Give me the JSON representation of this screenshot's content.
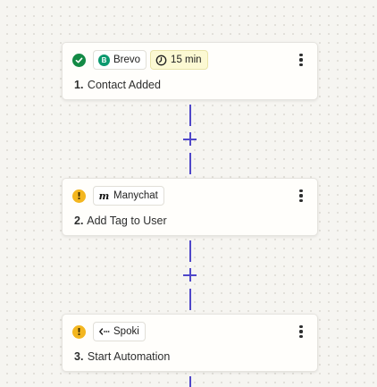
{
  "colors": {
    "canvas_background": "#f6f5f1",
    "connector": "#4f47c9",
    "status_success": "#138a45",
    "status_warning": "#f3b61f",
    "brevo_green": "#0b996e",
    "time_chip_bg": "#fcf9d3"
  },
  "steps": [
    {
      "number": "1.",
      "title": "Contact Added",
      "status": "success",
      "status_icon": "check-circle-icon",
      "app": {
        "name": "Brevo",
        "logo_letter": "B",
        "icon": "brevo-logo-icon"
      },
      "schedule": {
        "label": "15 min",
        "icon": "clock-icon"
      },
      "menu_icon": "more-vertical-icon"
    },
    {
      "number": "2.",
      "title": "Add Tag to User",
      "status": "warning",
      "status_icon": "warning-circle-icon",
      "status_glyph": "!",
      "app": {
        "name": "Manychat",
        "logo_letter": "m",
        "icon": "manychat-logo-icon"
      },
      "menu_icon": "more-vertical-icon"
    },
    {
      "number": "3.",
      "title": "Start Automation",
      "status": "warning",
      "status_icon": "warning-circle-icon",
      "status_glyph": "!",
      "app": {
        "name": "Spoki",
        "icon": "spoki-logo-icon"
      },
      "menu_icon": "more-vertical-icon"
    }
  ],
  "connectors": [
    {
      "between": [
        "1",
        "2"
      ],
      "add_button_icon": "plus-icon"
    },
    {
      "between": [
        "2",
        "3"
      ],
      "add_button_icon": "plus-icon"
    },
    {
      "between": [
        "3",
        "next"
      ]
    }
  ]
}
